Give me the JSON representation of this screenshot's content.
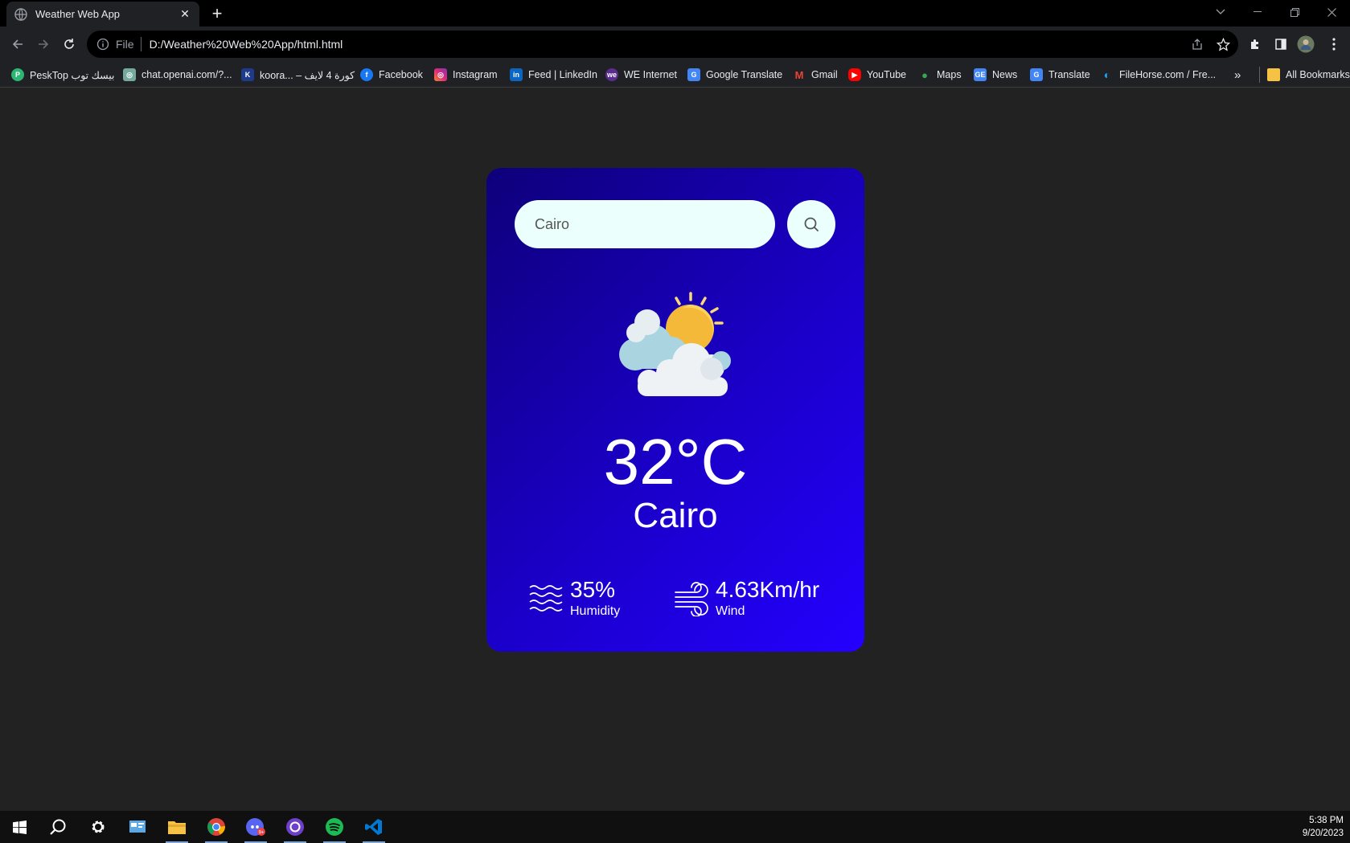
{
  "browser": {
    "tab_title": "Weather Web App",
    "url_scheme_label": "File",
    "url": "D:/Weather%20Web%20App/html.html",
    "bookmarks": [
      {
        "label": "PeskTop بيسك توب",
        "color": "#2bb673"
      },
      {
        "label": "chat.openai.com/?...",
        "color": "#74aa9c"
      },
      {
        "label": "koora... – كورة 4 لايف",
        "color": "#1e3a8a"
      },
      {
        "label": "Facebook",
        "color": "#1877f2"
      },
      {
        "label": "Instagram",
        "color": "#e1306c"
      },
      {
        "label": "Feed | LinkedIn",
        "color": "#0a66c2"
      },
      {
        "label": "WE Internet",
        "color": "#5b2d90"
      },
      {
        "label": "Google Translate",
        "color": "#4285f4"
      },
      {
        "label": "Gmail",
        "color": "#ea4335"
      },
      {
        "label": "YouTube",
        "color": "#ff0000"
      },
      {
        "label": "Maps",
        "color": "#34a853"
      },
      {
        "label": "News",
        "color": "#4285f4"
      },
      {
        "label": "Translate",
        "color": "#4285f4"
      },
      {
        "label": "FileHorse.com / Fre...",
        "color": "#1da1f2"
      }
    ],
    "more_bookmarks": "»",
    "all_bookmarks": "All Bookmarks"
  },
  "app": {
    "search": {
      "value": "Cairo"
    },
    "weather_icon": "partly-cloudy-sun-icon",
    "temperature": "32°C",
    "city": "Cairo",
    "humidity": {
      "value": "35%",
      "label": "Humidity"
    },
    "wind": {
      "value": "4.63Km/hr",
      "label": "Wind"
    },
    "colors": {
      "card_start": "#0e007a",
      "card_end": "#2400ff",
      "input_bg": "#ebfffc"
    }
  },
  "taskbar": {
    "time": "5:38 PM",
    "date": "9/20/2023",
    "items": [
      "windows-start",
      "search",
      "settings",
      "control-panel",
      "file-explorer",
      "chrome",
      "discord",
      "github-desktop",
      "spotify",
      "vscode"
    ]
  }
}
